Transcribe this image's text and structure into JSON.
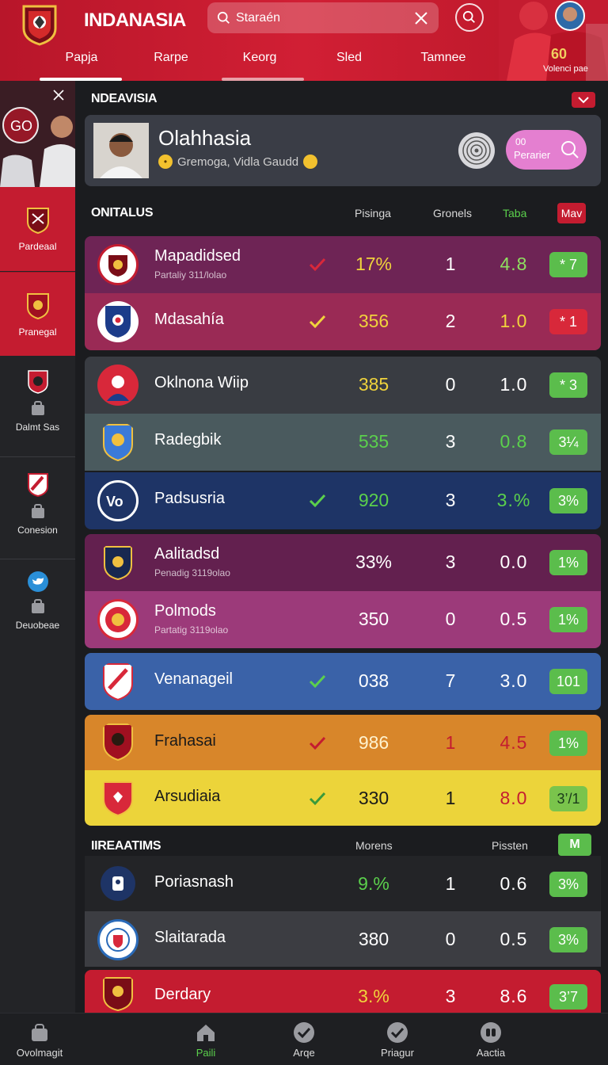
{
  "header": {
    "app_title": "INDANASIA",
    "search_placeholder": "Staraén",
    "hero_number": "60",
    "hero_caption": "Volenci pae"
  },
  "nav": {
    "tabs": [
      "Papja",
      "Rarpe",
      "Keorg",
      "Sled",
      "Tamnee"
    ]
  },
  "sidebar": {
    "hero_text": "GO",
    "items": [
      {
        "label": "Pardeaal"
      },
      {
        "label": "Pranegal"
      },
      {
        "label": "Dalmt Sas"
      },
      {
        "label": "Conesion"
      },
      {
        "label": "Deuobeae"
      }
    ]
  },
  "section1": {
    "title": "NDEAVISIA"
  },
  "featured": {
    "name": "Olahhasia",
    "meta": "Gremoga, Vidla Gaudd",
    "button_label": "Perarier",
    "button_small": "00"
  },
  "table1": {
    "title": "ONITALUS",
    "col1": "Pisinga",
    "col2": "Gronels",
    "col3": "Taba",
    "col4": "Mav"
  },
  "rows": [
    {
      "name": "Mapadidsed",
      "sub": "Partaliy 311/lolao",
      "check": "red",
      "v1": "17%",
      "v2": "1",
      "v3": "4.8",
      "tag": "* 7",
      "tag_color": "green"
    },
    {
      "name": "Mdasahía",
      "sub": "",
      "check": "yellow",
      "v1": "356",
      "v2": "2",
      "v3": "1.0",
      "tag": "* 1",
      "tag_color": "red"
    },
    {
      "name": "Oklnona Wiip",
      "sub": "",
      "check": "",
      "v1": "385",
      "v2": "0",
      "v3": "1.0",
      "tag": "* 3",
      "tag_color": "green"
    },
    {
      "name": "Radegbik",
      "sub": "",
      "check": "",
      "v1": "535",
      "v2": "3",
      "v3": "0.8",
      "tag": "3¼",
      "tag_color": "green"
    },
    {
      "name": "Padsusria",
      "sub": "",
      "check": "green",
      "v1": "920",
      "v2": "3",
      "v3": "3.%",
      "tag": "3%",
      "tag_color": "green"
    },
    {
      "name": "Aalitadsd",
      "sub": "Penadig 3119olao",
      "check": "",
      "v1": "33%",
      "v2": "3",
      "v3": "0.0",
      "tag": "1%",
      "tag_color": "green"
    },
    {
      "name": "Polmods",
      "sub": "Partatig 3119olao",
      "check": "",
      "v1": "350",
      "v2": "0",
      "v3": "0.5",
      "tag": "1%",
      "tag_color": "green"
    },
    {
      "name": "Venanageil",
      "sub": "",
      "check": "green",
      "v1": "038",
      "v2": "7",
      "v3": "3.0",
      "tag": "101",
      "tag_color": "green"
    },
    {
      "name": "Frahasai",
      "sub": "",
      "check": "red",
      "v1": "986",
      "v2": "1",
      "v3": "4.5",
      "tag": "1%",
      "tag_color": "green"
    },
    {
      "name": "Arsudiaia",
      "sub": "",
      "check": "green",
      "v1": "330",
      "v2": "1",
      "v3": "8.0",
      "tag": "3’/1",
      "tag_color": "green"
    }
  ],
  "table2": {
    "title": "IIREAATIMS",
    "col1": "Morens",
    "col2": "Pissten",
    "col3": "M"
  },
  "rows2": [
    {
      "name": "Poriasnash",
      "v1": "9.%",
      "v2": "1",
      "v3": "0.6",
      "tag": "3%"
    },
    {
      "name": "Slaitarada",
      "v1": "380",
      "v2": "0",
      "v3": "0.5",
      "tag": "3%"
    },
    {
      "name": "Derdary",
      "v1": "3.%",
      "v2": "3",
      "v3": "8.6",
      "tag": "3’7"
    }
  ],
  "bottom_nav": [
    {
      "label": "Ovolmagit",
      "icon": "bag-icon"
    },
    {
      "label": "Paili",
      "icon": "home-icon"
    },
    {
      "label": "Arqe",
      "icon": "check-circle-icon"
    },
    {
      "label": "Priagur",
      "icon": "check-circle-icon"
    },
    {
      "label": "Aactia",
      "icon": "chat-icon"
    }
  ],
  "colors": {
    "brand_red": "#c41c30",
    "accent_green": "#5bbd4c",
    "accent_yellow": "#f0d33c"
  }
}
